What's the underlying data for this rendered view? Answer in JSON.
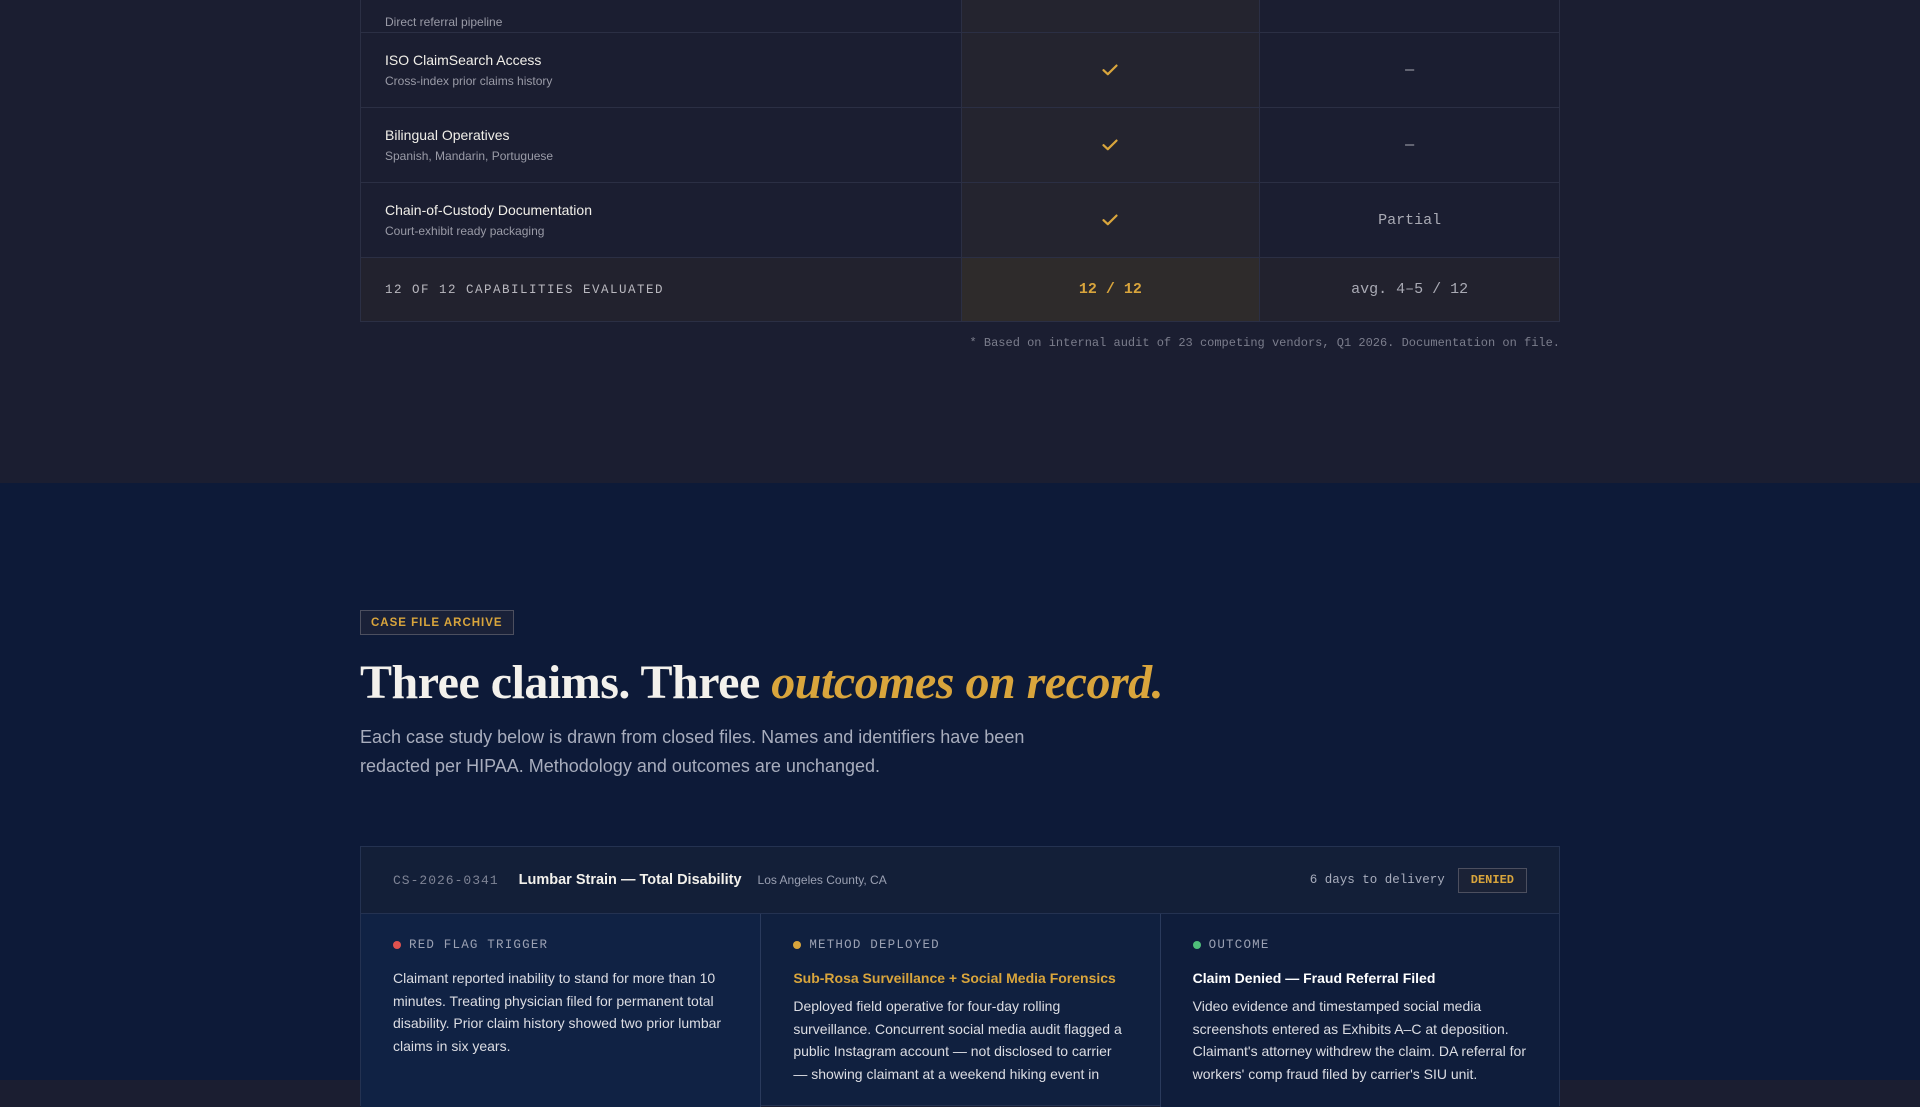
{
  "comparison": {
    "partial_row": {
      "desc": "Direct referral pipeline"
    },
    "rows": [
      {
        "name": "ISO ClaimSearch Access",
        "desc": "Cross-index prior claims history",
        "competitor": "—"
      },
      {
        "name": "Bilingual Operatives",
        "desc": "Spanish, Mandarin, Portuguese",
        "competitor": "—"
      },
      {
        "name": "Chain-of-Custody Documentation",
        "desc": "Court-exhibit ready packaging",
        "competitor": "Partial"
      }
    ],
    "check_icon": "checkmark-icon",
    "summary": {
      "label": "12 OF 12 CAPABILITIES EVALUATED",
      "our_score": "12 / 12",
      "competitor_score": "avg. 4–5 / 12"
    },
    "footnote": "* Based on internal audit of 23 competing vendors, Q1 2026. Documentation on file."
  },
  "case_section": {
    "badge": "CASE FILE ARCHIVE",
    "heading_main": "Three claims. Three ",
    "heading_accent": "outcomes on record.",
    "intro": "Each case study below is drawn from closed files. Names and identifiers have been redacted per HIPAA. Methodology and outcomes are unchanged.",
    "case": {
      "id": "CS-2026-0341",
      "title": "Lumbar Strain — Total Disability",
      "location": "Los Angeles County, CA",
      "delivery": "6 days to delivery",
      "status": "DENIED",
      "columns": [
        {
          "label": "RED FLAG TRIGGER",
          "dot_color": "#e0524f",
          "heading": "",
          "text": "Claimant reported inability to stand for more than 10 minutes. Treating physician filed for permanent total disability. Prior claim history showed two prior lumbar claims in six years."
        },
        {
          "label": "METHOD DEPLOYED",
          "dot_color": "#d9a53c",
          "heading": "Sub-Rosa Surveillance + Social Media Forensics",
          "text": "Deployed field operative for four-day rolling surveillance. Concurrent social media audit flagged a public Instagram account — not disclosed to carrier — showing claimant at a weekend hiking event in"
        },
        {
          "label": "OUTCOME",
          "dot_color": "#4fbf7a",
          "heading": "Claim Denied — Fraud Referral Filed",
          "text": "Video evidence and timestamped social media screenshots entered as Exhibits A–C at deposition. Claimant's attorney withdrew the claim. DA referral for workers' comp fraud filed by carrier's SIU unit."
        }
      ]
    }
  },
  "colors": {
    "accent_gold": "#d9a53c",
    "navy": "#0d1a38",
    "charcoal": "#1b1e31"
  }
}
